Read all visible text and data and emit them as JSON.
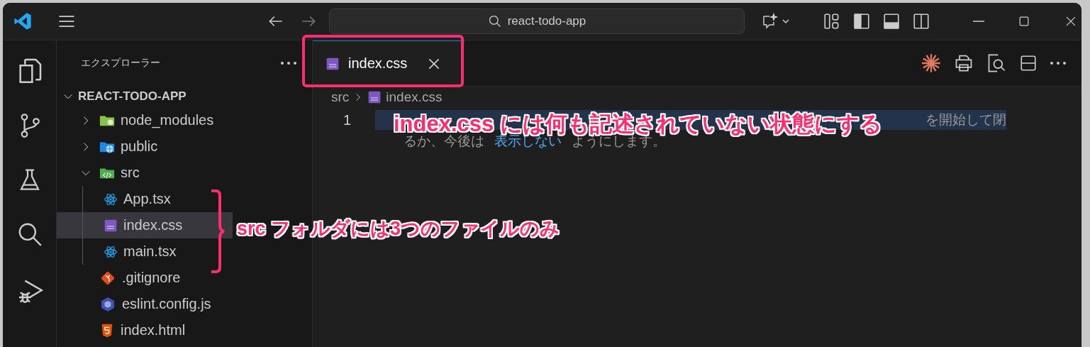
{
  "title_bar": {
    "search": "react-todo-app"
  },
  "sidebar": {
    "title": "エクスプローラー",
    "root": {
      "label": "REACT-TODO-APP",
      "expanded": true
    },
    "items": [
      {
        "label": "node_modules",
        "kind": "nodefolder",
        "expanded": false,
        "selected": false
      },
      {
        "label": "public",
        "kind": "webfolder",
        "expanded": false,
        "selected": false
      },
      {
        "label": "src",
        "kind": "codefolder",
        "expanded": true,
        "selected": false,
        "children": [
          {
            "label": "App.tsx",
            "kind": "react",
            "selected": false
          },
          {
            "label": "index.css",
            "kind": "css",
            "selected": true
          },
          {
            "label": "main.tsx",
            "kind": "react",
            "selected": false
          }
        ]
      },
      {
        "label": ".gitignore",
        "kind": "git",
        "selected": false
      },
      {
        "label": "eslint.config.js",
        "kind": "eslint",
        "selected": false
      },
      {
        "label": "index.html",
        "kind": "html",
        "selected": false
      }
    ]
  },
  "tabs": [
    {
      "label": "index.css",
      "selected": true
    }
  ],
  "breadcrumb": [
    "src",
    "index.css"
  ],
  "editor": {
    "line_number": "1",
    "hint_fragment": "を開始して閉",
    "hint_line_2": [
      "るか、今後は",
      "表示しない",
      "ようにします。"
    ]
  },
  "annotations": [
    {
      "text": "index.css には何も記述されていない状態にする"
    },
    {
      "text": "src フォルダには3つのファイルのみ"
    }
  ]
}
